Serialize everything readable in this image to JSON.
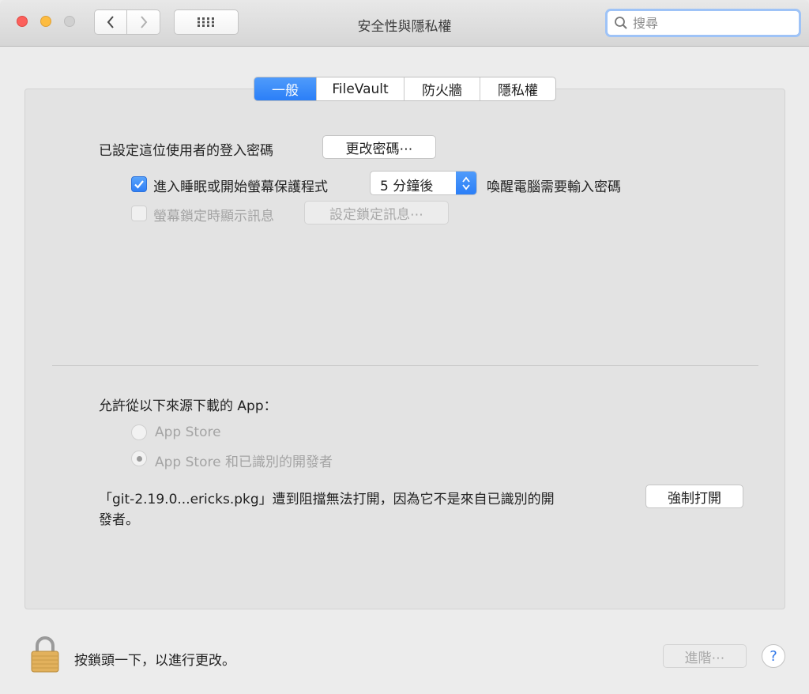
{
  "window": {
    "title": "安全性與隱私權"
  },
  "search": {
    "placeholder": "搜尋"
  },
  "tabs": [
    {
      "label": "一般",
      "active": true
    },
    {
      "label": "FileVault",
      "active": false
    },
    {
      "label": "防火牆",
      "active": false
    },
    {
      "label": "隱私權",
      "active": false
    }
  ],
  "general": {
    "password_label": "已設定這位使用者的登入密碼",
    "change_password_button": "更改密碼⋯",
    "require_password": {
      "checked": true,
      "label": "進入睡眠或開始螢幕保護程式",
      "select_value": "5 分鐘後",
      "suffix": "喚醒電腦需要輸入密碼"
    },
    "lock_message": {
      "checked": false,
      "label": "螢幕鎖定時顯示訊息",
      "button": "設定鎖定訊息⋯"
    }
  },
  "downloads": {
    "heading": "允許從以下來源下載的 App：",
    "options": [
      {
        "label": "App Store",
        "selected": false
      },
      {
        "label": "App Store 和已識別的開發者",
        "selected": true
      }
    ],
    "blocked_line1": "「git-2.19.0...ericks.pkg」遭到阻擋無法打開，因為它不是來自已識別的開",
    "blocked_line2": "發者。",
    "open_anyway_button": "強制打開"
  },
  "footer": {
    "lock_text": "按鎖頭一下，以進行更改。",
    "advanced_button": "進階⋯",
    "help_label": "?"
  },
  "colors": {
    "accent": "#2b7ff7",
    "lock_gold": "#e2b15c"
  }
}
